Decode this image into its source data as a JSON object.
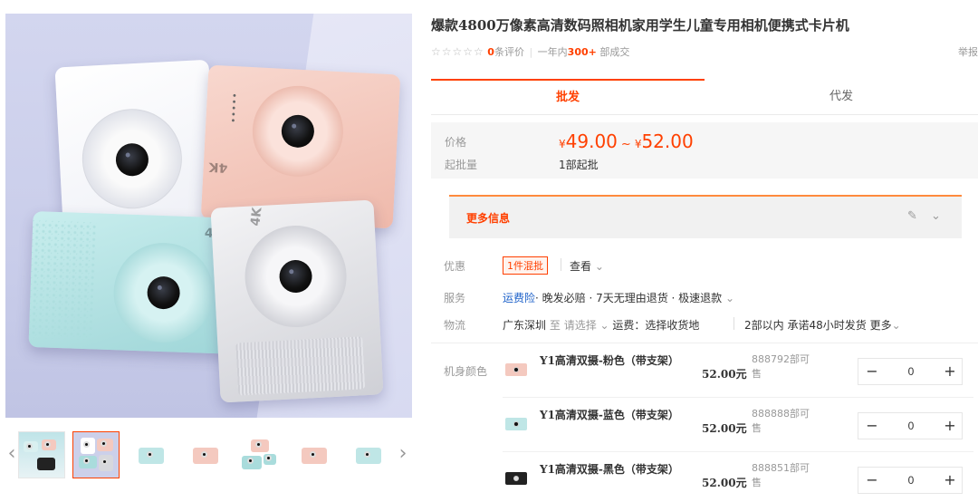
{
  "title": "爆款4800万像素高清数码照相机家用学生儿童专用相机便携式卡片机",
  "rating": {
    "stars": "☆☆☆☆☆",
    "review_count": "0",
    "review_suffix": "条评价",
    "sep": "|",
    "year_prefix": "一年内",
    "sold": "300+",
    "sold_suffix": "部成交"
  },
  "report_label": "举报",
  "gallery": {
    "main_image_label": "4K",
    "prev_icon": "chevron-left-icon",
    "next_icon": "chevron-right-icon",
    "thumb_count": 8,
    "active_thumb": 2
  },
  "tabs": [
    {
      "label": "批发",
      "active": true
    },
    {
      "label": "代发",
      "active": false
    }
  ],
  "price": {
    "label": "价格",
    "currency": "¥",
    "low": "49.00",
    "range_sep": "~",
    "high": "52.00",
    "min_label": "起批量",
    "min_value": "1部起批"
  },
  "more_info": {
    "label": "更多信息",
    "edit_icon": "pencil-icon",
    "expand_icon": "chevron-down-icon"
  },
  "promo": {
    "label": "优惠",
    "tag": "1件混批",
    "link": "查看",
    "link_icon": "chevron-down-icon"
  },
  "service": {
    "label": "服务",
    "insurance": "运费险",
    "items": "· 晚发必赔 · 7天无理由退货 · 极速退款",
    "icon": "chevron-down-icon"
  },
  "logistics": {
    "label": "物流",
    "from": "广东深圳",
    "to_prefix": "至",
    "to_select": "请选择",
    "freight": "运费：选择收货地",
    "ship_promise": "2部以内 承诺48小时发货",
    "more": "更多"
  },
  "sku_label": "机身颜色",
  "skus": [
    {
      "name": "Y1高清双摄-粉色（带支架）",
      "price": "52.00元",
      "stock": "888792部可售",
      "qty": "0",
      "color": "#f4c9bf"
    },
    {
      "name": "Y1高清双摄-蓝色（带支架）",
      "price": "52.00元",
      "stock": "888888部可售",
      "qty": "0",
      "color": "#bfe6e6"
    },
    {
      "name": "Y1高清双摄-黑色（带支架）",
      "price": "52.00元",
      "stock": "888851部可售",
      "qty": "0",
      "color": "#222222"
    }
  ],
  "stepper": {
    "minus": "−",
    "plus": "+"
  },
  "colors": {
    "accent": "#ff4000",
    "link": "#1d61c9",
    "price_bg": "#f6f6f6"
  }
}
